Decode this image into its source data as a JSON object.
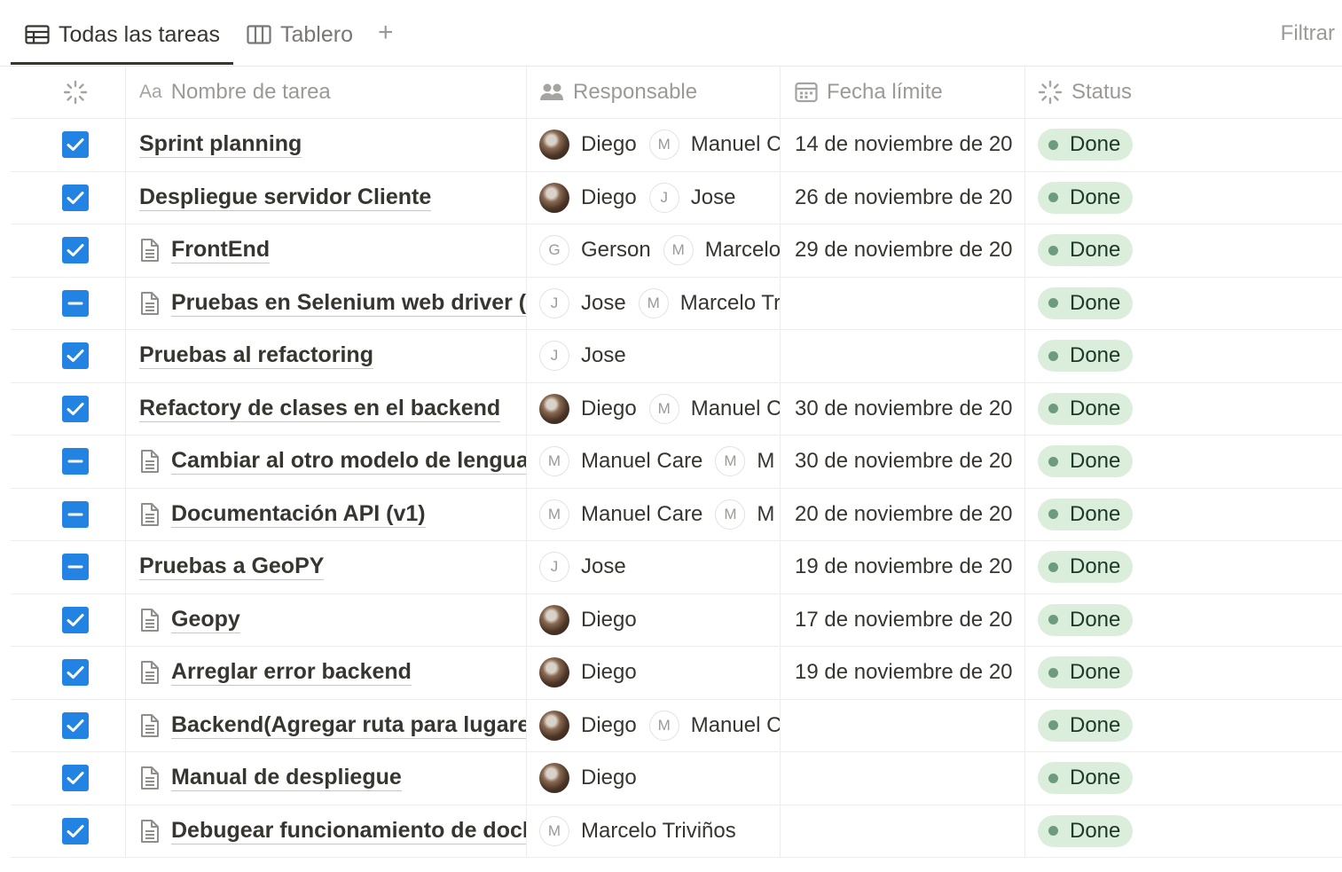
{
  "tabs": {
    "active_label": "Todas las tareas",
    "board_label": "Tablero",
    "add_label": "+",
    "filter_label": "Filtrar"
  },
  "columns": {
    "name": "Nombre de tarea",
    "name_prefix": "Aa",
    "assignee": "Responsable",
    "due": "Fecha límite",
    "status": "Status"
  },
  "rows": [
    {
      "check": "checked",
      "doc": false,
      "name": "Sprint planning",
      "people": [
        {
          "initial": "",
          "photo": true,
          "name": "Diego"
        },
        {
          "initial": "M",
          "photo": false,
          "name": "Manuel C"
        }
      ],
      "due": "14 de noviembre de 20",
      "status": "Done"
    },
    {
      "check": "checked",
      "doc": false,
      "name": "Despliegue servidor Cliente",
      "people": [
        {
          "initial": "",
          "photo": true,
          "name": "Diego"
        },
        {
          "initial": "J",
          "photo": false,
          "name": "Jose"
        }
      ],
      "due": "26 de noviembre de 20",
      "status": "Done"
    },
    {
      "check": "checked",
      "doc": true,
      "name": "FrontEnd",
      "people": [
        {
          "initial": "G",
          "photo": false,
          "name": "Gerson"
        },
        {
          "initial": "M",
          "photo": false,
          "name": "Marcelo"
        }
      ],
      "due": "29 de noviembre de 20",
      "status": "Done"
    },
    {
      "check": "partial",
      "doc": true,
      "name": "Pruebas en Selenium web driver (F",
      "people": [
        {
          "initial": "J",
          "photo": false,
          "name": "Jose"
        },
        {
          "initial": "M",
          "photo": false,
          "name": "Marcelo Tr"
        }
      ],
      "due": "",
      "status": "Done"
    },
    {
      "check": "checked",
      "doc": false,
      "name": "Pruebas al refactoring",
      "people": [
        {
          "initial": "J",
          "photo": false,
          "name": "Jose"
        }
      ],
      "due": "",
      "status": "Done"
    },
    {
      "check": "checked",
      "doc": false,
      "name": "Refactory de clases en el backend",
      "people": [
        {
          "initial": "",
          "photo": true,
          "name": "Diego"
        },
        {
          "initial": "M",
          "photo": false,
          "name": "Manuel C"
        }
      ],
      "due": "30 de noviembre de 20",
      "status": "Done"
    },
    {
      "check": "partial",
      "doc": true,
      "name": "Cambiar al otro modelo de lengua",
      "people": [
        {
          "initial": "M",
          "photo": false,
          "name": "Manuel Care"
        },
        {
          "initial": "M",
          "photo": false,
          "name": "M"
        }
      ],
      "due": "30 de noviembre de 20",
      "status": "Done"
    },
    {
      "check": "partial",
      "doc": true,
      "name": "Documentación API (v1)",
      "people": [
        {
          "initial": "M",
          "photo": false,
          "name": "Manuel Care"
        },
        {
          "initial": "M",
          "photo": false,
          "name": "M"
        }
      ],
      "due": "20 de noviembre de 20",
      "status": "Done"
    },
    {
      "check": "partial",
      "doc": false,
      "name": "Pruebas a GeoPY",
      "people": [
        {
          "initial": "J",
          "photo": false,
          "name": "Jose"
        }
      ],
      "due": "19 de noviembre de 20",
      "status": "Done"
    },
    {
      "check": "checked",
      "doc": true,
      "name": "Geopy",
      "people": [
        {
          "initial": "",
          "photo": true,
          "name": "Diego"
        }
      ],
      "due": "17 de noviembre de 20",
      "status": "Done"
    },
    {
      "check": "checked",
      "doc": true,
      "name": "Arreglar error backend",
      "people": [
        {
          "initial": "",
          "photo": true,
          "name": "Diego"
        }
      ],
      "due": "19 de noviembre de 20",
      "status": "Done"
    },
    {
      "check": "checked",
      "doc": true,
      "name": "Backend(Agregar ruta para lugares",
      "people": [
        {
          "initial": "",
          "photo": true,
          "name": "Diego"
        },
        {
          "initial": "M",
          "photo": false,
          "name": "Manuel C"
        }
      ],
      "due": "",
      "status": "Done"
    },
    {
      "check": "checked",
      "doc": true,
      "name": "Manual de despliegue",
      "people": [
        {
          "initial": "",
          "photo": true,
          "name": "Diego"
        }
      ],
      "due": "",
      "status": "Done"
    },
    {
      "check": "checked",
      "doc": true,
      "name": "Debugear funcionamiento de dock",
      "people": [
        {
          "initial": "M",
          "photo": false,
          "name": "Marcelo Triviños"
        }
      ],
      "due": "",
      "status": "Done"
    }
  ],
  "colors": {
    "checkbox": "#2383e2",
    "status_bg": "#dbeddb",
    "status_dot": "#6c9b7d",
    "status_text": "#1c3829"
  },
  "icons": {
    "table_view": "table-icon",
    "board_view": "board-icon",
    "status_col": "loading-icon",
    "people_col": "people-icon",
    "date_col": "calendar-icon",
    "page": "page-icon"
  }
}
